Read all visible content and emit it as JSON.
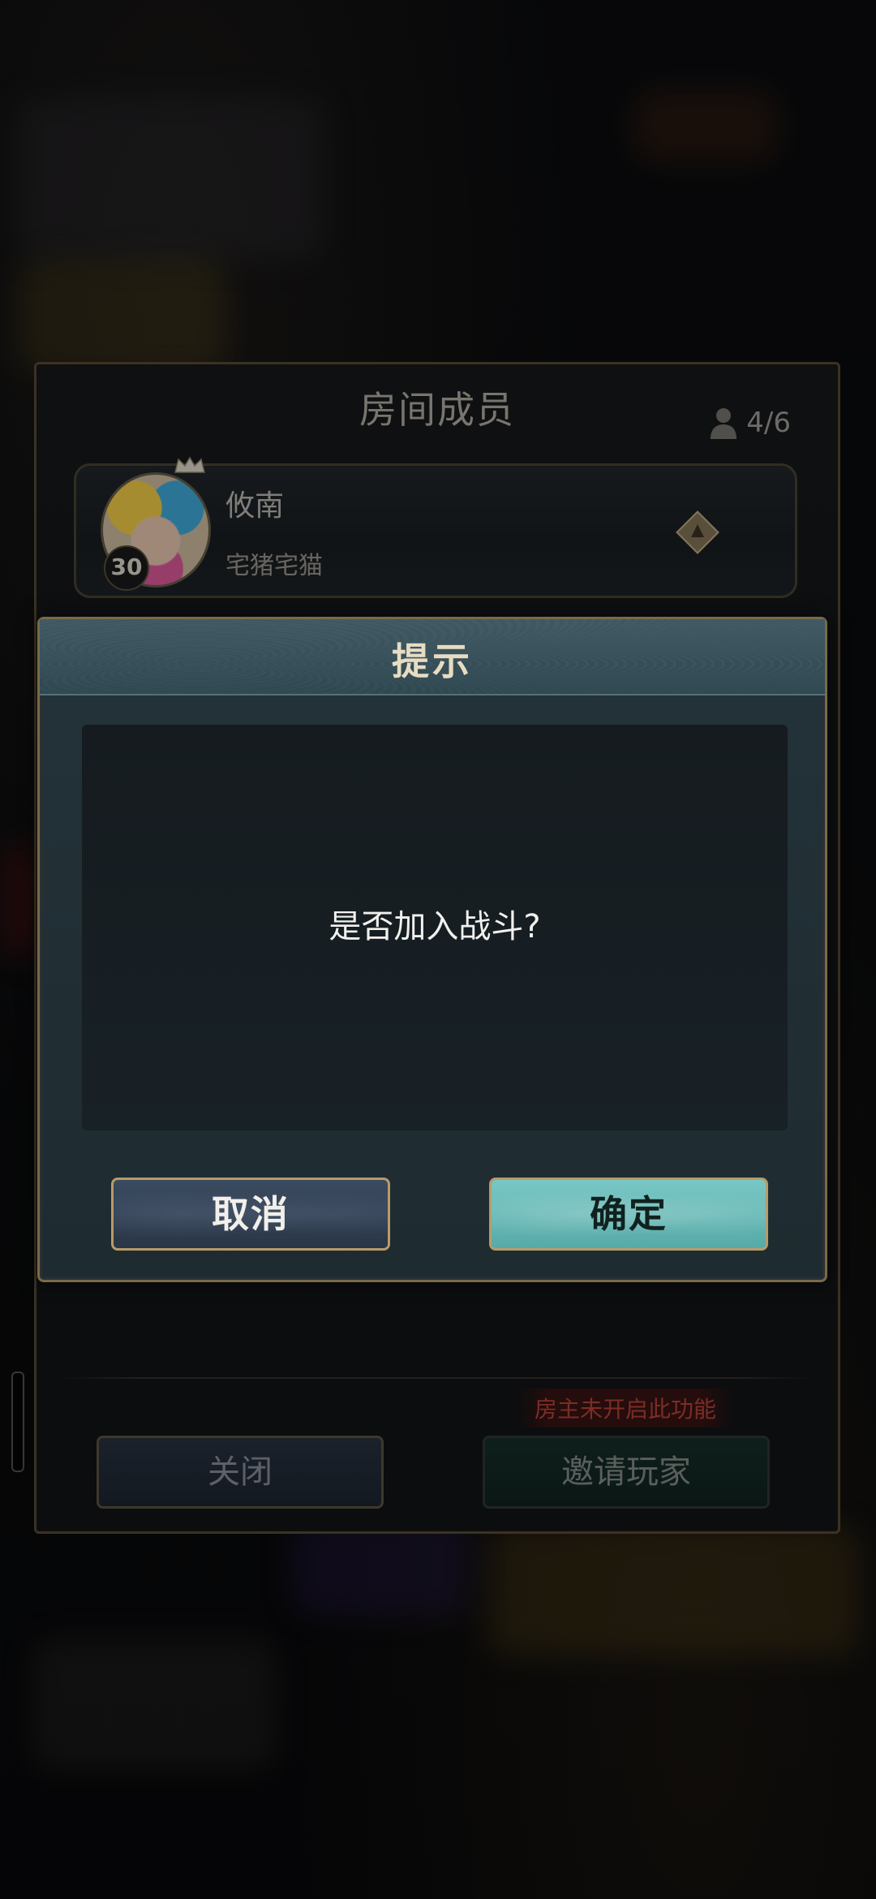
{
  "room": {
    "title": "房间成员",
    "count": "4/6",
    "member": {
      "name": "攸南",
      "guild": "宅猪宅猫",
      "level": "30"
    },
    "host_note": "房主未开启此功能",
    "close_label": "关闭",
    "invite_label": "邀请玩家"
  },
  "dialog": {
    "title": "提示",
    "message": "是否加入战斗?",
    "cancel_label": "取消",
    "confirm_label": "确定"
  },
  "colors": {
    "confirm_accent": "#6bbcb9",
    "cancel_accent": "#34435a",
    "warning_text": "#c0443b",
    "gold_border": "#b89b68"
  },
  "icons": [
    "person-icon",
    "crown-icon",
    "rank-icon"
  ]
}
